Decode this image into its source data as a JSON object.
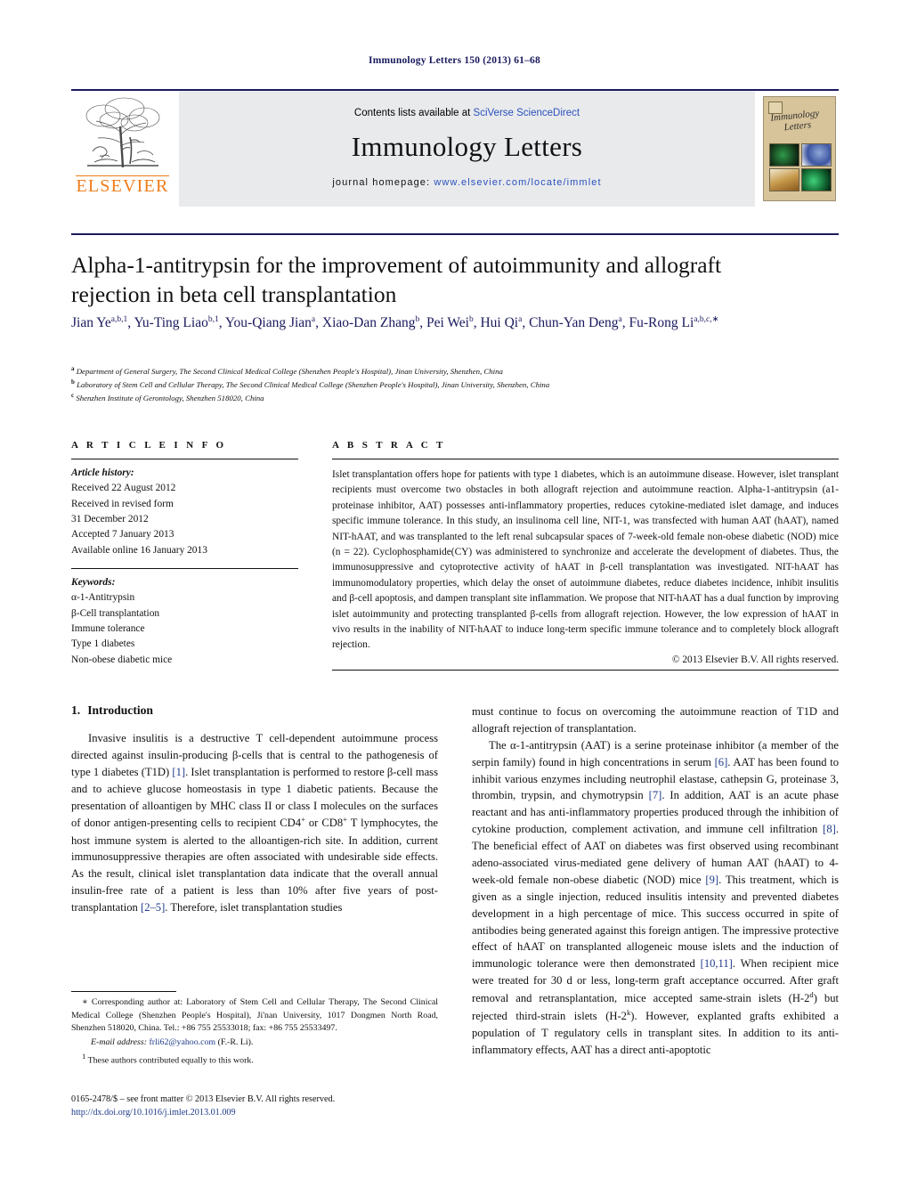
{
  "running_head": "Immunology Letters 150 (2013) 61–68",
  "masthead": {
    "publisher_name": "ELSEVIER",
    "contents_prefix": "Contents lists available at ",
    "contents_link": "SciVerse ScienceDirect",
    "journal_name": "Immunology Letters",
    "homepage_label": "journal homepage:",
    "homepage_url": "www.elsevier.com/locate/immlet",
    "cover_title_line1": "Immunology",
    "cover_title_line2": "Letters"
  },
  "article": {
    "title": "Alpha-1-antitrypsin for the improvement of autoimmunity and allograft rejection in beta cell transplantation",
    "authors_html": "Jian Ye<sup>a,b,1</sup>, Yu-Ting Liao<sup>b,1</sup>, You-Qiang Jian<sup>a</sup>, Xiao-Dan Zhang<sup>b</sup>, Pei Wei<sup>b</sup>, Hui Qi<sup>a</sup>, Chun-Yan Deng<sup>a</sup>, Fu-Rong Li<sup>a,b,c,∗</sup>",
    "affiliations": [
      {
        "marker": "a",
        "text": "Department of General Surgery, The Second Clinical Medical College (Shenzhen People's Hospital), Jinan University, Shenzhen, China"
      },
      {
        "marker": "b",
        "text": "Laboratory of Stem Cell and Cellular Therapy, The Second Clinical Medical College (Shenzhen People's Hospital), Jinan University, Shenzhen, China"
      },
      {
        "marker": "c",
        "text": "Shenzhen Institute of Gerontology, Shenzhen 518020, China"
      }
    ]
  },
  "article_info": {
    "heading": "A R T I C L E  I N F O",
    "history_label": "Article history:",
    "history_lines": [
      "Received 22 August 2012",
      "Received in revised form",
      "31 December 2012",
      "Accepted 7 January 2013",
      "Available online 16 January 2013"
    ],
    "keywords_label": "Keywords:",
    "keywords": [
      "α-1-Antitrypsin",
      "β-Cell transplantation",
      "Immune tolerance",
      "Type 1 diabetes",
      "Non-obese diabetic mice"
    ]
  },
  "abstract": {
    "heading": "A B S T R A C T",
    "text": "Islet transplantation offers hope for patients with type 1 diabetes, which is an autoimmune disease. However, islet transplant recipients must overcome two obstacles in both allograft rejection and autoimmune reaction. Alpha-1-antitrypsin (a1-proteinase inhibitor, AAT) possesses anti-inflammatory properties, reduces cytokine-mediated islet damage, and induces specific immune tolerance. In this study, an insulinoma cell line, NIT-1, was transfected with human AAT (hAAT), named NIT-hAAT, and was transplanted to the left renal subcapsular spaces of 7-week-old female non-obese diabetic (NOD) mice (n = 22). Cyclophosphamide(CY) was administered to synchronize and accelerate the development of diabetes. Thus, the immunosuppressive and cytoprotective activity of hAAT in β-cell transplantation was investigated. NIT-hAAT has immunomodulatory properties, which delay the onset of autoimmune diabetes, reduce diabetes incidence, inhibit insulitis and β-cell apoptosis, and dampen transplant site inflammation. We propose that NIT-hAAT has a dual function by improving islet autoimmunity and protecting transplanted β-cells from allograft rejection. However, the low expression of hAAT in vivo results in the inability of NIT-hAAT to induce long-term specific immune tolerance and to completely block allograft rejection.",
    "copyright": "© 2013 Elsevier B.V. All rights reserved."
  },
  "body": {
    "section_number": "1.",
    "section_title": "Introduction",
    "left_paragraph_html": "Invasive insulitis is a destructive T cell-dependent autoimmune process directed against insulin-producing β-cells that is central to the pathogenesis of type 1 diabetes (T1D) <span class=\"ref\">[1]</span>. Islet transplantation is performed to restore β-cell mass and to achieve glucose homeostasis in type 1 diabetic patients. Because the presentation of alloantigen by MHC class II or class I molecules on the surfaces of donor antigen-presenting cells to recipient CD4<sup class=\"sp\">+</sup> or CD8<sup class=\"sp\">+</sup> T lymphocytes, the host immune system is alerted to the alloantigen-rich site. In addition, current immunosuppressive therapies are often associated with undesirable side effects. As the result, clinical islet transplantation data indicate that the overall annual insulin-free rate of a patient is less than 10% after five years of post-transplantation <span class=\"ref\">[2–5]</span>. Therefore, islet transplantation studies",
    "right_paragraph1_html": "must continue to focus on overcoming the autoimmune reaction of T1D and allograft rejection of transplantation.",
    "right_paragraph2_html": "The α-1-antitrypsin (AAT) is a serine proteinase inhibitor (a member of the serpin family) found in high concentrations in serum <span class=\"ref\">[6]</span>. AAT has been found to inhibit various enzymes including neutrophil elastase, cathepsin G, proteinase 3, thrombin, trypsin, and chymotrypsin <span class=\"ref\">[7]</span>. In addition, AAT is an acute phase reactant and has anti-inflammatory properties produced through the inhibition of cytokine production, complement activation, and immune cell infiltration <span class=\"ref\">[8]</span>. The beneficial effect of AAT on diabetes was first observed using recombinant adeno-associated virus-mediated gene delivery of human AAT (hAAT) to 4-week-old female non-obese diabetic (NOD) mice <span class=\"ref\">[9]</span>. This treatment, which is given as a single injection, reduced insulitis intensity and prevented diabetes development in a high percentage of mice. This success occurred in spite of antibodies being generated against this foreign antigen. The impressive protective effect of hAAT on transplanted allogeneic mouse islets and the induction of immunologic tolerance were then demonstrated <span class=\"ref\">[10,11]</span>. When recipient mice were treated for 30 d or less, long-term graft acceptance occurred. After graft removal and retransplantation, mice accepted same-strain islets (H-2<sup class=\"sp\">d</sup>) but rejected third-strain islets (H-2<sup class=\"sp\">k</sup>). However, explanted grafts exhibited a population of T regulatory cells in transplant sites. In addition to its anti-inflammatory effects, AAT has a direct anti-apoptotic"
  },
  "footnotes": {
    "corresponding_html": "<span class=\"it\"></span>∗ Corresponding author at: Laboratory of Stem Cell and Cellular Therapy, The Second Clinical Medical College (Shenzhen People's Hospital), Ji'nan University, 1017 Dongmen North Road, Shenzhen 518020, China. Tel.: +86 755 25533018; fax: +86 755 25533497.",
    "email_html": "<span class=\"it\">E-mail address:</span> <span class=\"link\">frli62@yahoo.com</span> (F.-R. Li).",
    "equal_contrib_html": "<sup class=\"sp\">1</sup> These authors contributed equally to this work."
  },
  "issn": {
    "line1": "0165-2478/$ – see front matter © 2013 Elsevier B.V. All rights reserved.",
    "doi": "http://dx.doi.org/10.1016/j.imlet.2013.01.009"
  }
}
